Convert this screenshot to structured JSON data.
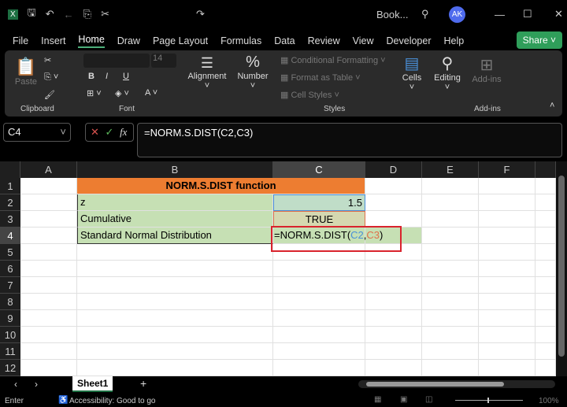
{
  "titlebar": {
    "title": "Book...",
    "avatar": "AK",
    "icons": [
      "excel-icon",
      "save-icon",
      "undo-icon",
      "back-icon",
      "copy-icon",
      "cut-icon",
      "redo-icon",
      "search-icon"
    ]
  },
  "menu": [
    "File",
    "Insert",
    "Home",
    "Draw",
    "Page Layout",
    "Formulas",
    "Data",
    "Review",
    "View",
    "Developer",
    "Help"
  ],
  "share": "Share",
  "ribbon": {
    "paste": "Paste",
    "clipboard": "Clipboard",
    "font": "Font",
    "font_size": "14",
    "bold": "B",
    "italic": "I",
    "underline": "U",
    "alignment": "Alignment",
    "number": "Number",
    "cond_fmt": "Conditional Formatting",
    "fmt_table": "Format as Table",
    "cell_styles": "Cell Styles",
    "styles": "Styles",
    "cells": "Cells",
    "editing": "Editing",
    "addins": "Add-ins",
    "addins_group": "Add-ins"
  },
  "formula_bar": {
    "name_box": "C4",
    "formula": "=NORM.S.DIST(C2,C3)"
  },
  "columns": [
    "A",
    "B",
    "C",
    "D",
    "E",
    "F"
  ],
  "rows": [
    "1",
    "2",
    "3",
    "4",
    "5",
    "6",
    "7",
    "8",
    "9",
    "10",
    "11",
    "12"
  ],
  "cells": {
    "B1": "NORM.S.DIST function",
    "B2": "z",
    "C2": "1.5",
    "B3": "Cumulative",
    "C3": "TRUE",
    "B4": "Standard Normal Distribution",
    "C4_prefix": "=NORM.S.DIST(",
    "C4_ref1": "C2",
    "C4_comma": ",",
    "C4_ref2": "C3",
    "C4_suffix": ")"
  },
  "colors": {
    "header": "#ed7d31",
    "fill": "#c6e0b4",
    "ref1": "#4a90d9",
    "ref2": "#e0704a",
    "highlight": "#d9232d"
  },
  "sheet_tab": "Sheet1",
  "status": {
    "mode": "Enter",
    "accessibility": "Accessibility: Good to go",
    "zoom": "100%"
  }
}
